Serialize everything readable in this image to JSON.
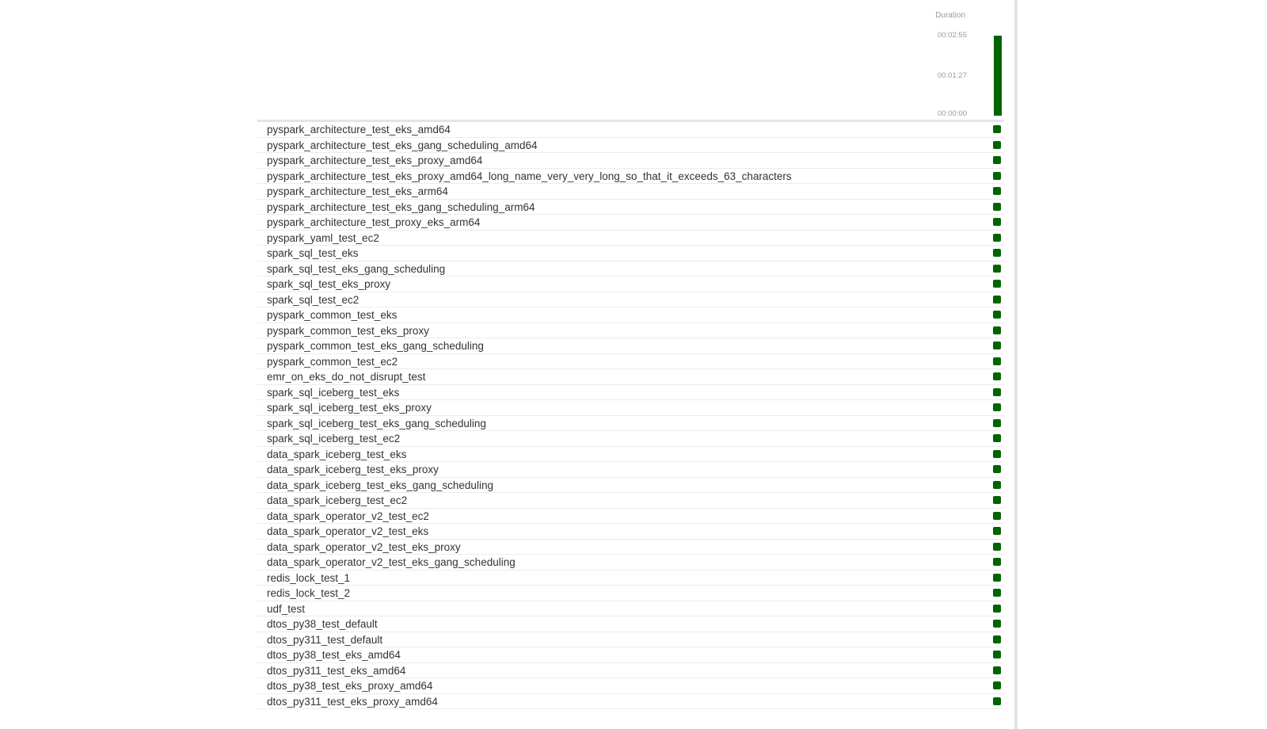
{
  "header": {
    "duration_label": "Duration",
    "axis": {
      "max_label": "00:02:55",
      "mid_label": "00:01:27",
      "min_label": "00:00:00"
    },
    "duration_bar": {
      "value_fraction_of_max": 1.0,
      "color": "#006400",
      "state": "success"
    }
  },
  "colors": {
    "success": "#006400",
    "row_divider": "#ececec",
    "header_divider": "#dfe5ec",
    "text": "#333333",
    "muted_text": "#999999"
  },
  "tasks": [
    {
      "name": "pyspark_architecture_test_eks_amd64",
      "state": "success"
    },
    {
      "name": "pyspark_architecture_test_eks_gang_scheduling_amd64",
      "state": "success"
    },
    {
      "name": "pyspark_architecture_test_eks_proxy_amd64",
      "state": "success"
    },
    {
      "name": "pyspark_architecture_test_eks_proxy_amd64_long_name_very_very_long_so_that_it_exceeds_63_characters",
      "state": "success"
    },
    {
      "name": "pyspark_architecture_test_eks_arm64",
      "state": "success"
    },
    {
      "name": "pyspark_architecture_test_eks_gang_scheduling_arm64",
      "state": "success"
    },
    {
      "name": "pyspark_architecture_test_proxy_eks_arm64",
      "state": "success"
    },
    {
      "name": "pyspark_yaml_test_ec2",
      "state": "success"
    },
    {
      "name": "spark_sql_test_eks",
      "state": "success"
    },
    {
      "name": "spark_sql_test_eks_gang_scheduling",
      "state": "success"
    },
    {
      "name": "spark_sql_test_eks_proxy",
      "state": "success"
    },
    {
      "name": "spark_sql_test_ec2",
      "state": "success"
    },
    {
      "name": "pyspark_common_test_eks",
      "state": "success"
    },
    {
      "name": "pyspark_common_test_eks_proxy",
      "state": "success"
    },
    {
      "name": "pyspark_common_test_eks_gang_scheduling",
      "state": "success"
    },
    {
      "name": "pyspark_common_test_ec2",
      "state": "success"
    },
    {
      "name": "emr_on_eks_do_not_disrupt_test",
      "state": "success"
    },
    {
      "name": "spark_sql_iceberg_test_eks",
      "state": "success"
    },
    {
      "name": "spark_sql_iceberg_test_eks_proxy",
      "state": "success"
    },
    {
      "name": "spark_sql_iceberg_test_eks_gang_scheduling",
      "state": "success"
    },
    {
      "name": "spark_sql_iceberg_test_ec2",
      "state": "success"
    },
    {
      "name": "data_spark_iceberg_test_eks",
      "state": "success"
    },
    {
      "name": "data_spark_iceberg_test_eks_proxy",
      "state": "success"
    },
    {
      "name": "data_spark_iceberg_test_eks_gang_scheduling",
      "state": "success"
    },
    {
      "name": "data_spark_iceberg_test_ec2",
      "state": "success"
    },
    {
      "name": "data_spark_operator_v2_test_ec2",
      "state": "success"
    },
    {
      "name": "data_spark_operator_v2_test_eks",
      "state": "success"
    },
    {
      "name": "data_spark_operator_v2_test_eks_proxy",
      "state": "success"
    },
    {
      "name": "data_spark_operator_v2_test_eks_gang_scheduling",
      "state": "success"
    },
    {
      "name": "redis_lock_test_1",
      "state": "success"
    },
    {
      "name": "redis_lock_test_2",
      "state": "success"
    },
    {
      "name": "udf_test",
      "state": "success"
    },
    {
      "name": "dtos_py38_test_default",
      "state": "success"
    },
    {
      "name": "dtos_py311_test_default",
      "state": "success"
    },
    {
      "name": "dtos_py38_test_eks_amd64",
      "state": "success"
    },
    {
      "name": "dtos_py311_test_eks_amd64",
      "state": "success"
    },
    {
      "name": "dtos_py38_test_eks_proxy_amd64",
      "state": "success"
    },
    {
      "name": "dtos_py311_test_eks_proxy_amd64",
      "state": "success"
    }
  ]
}
